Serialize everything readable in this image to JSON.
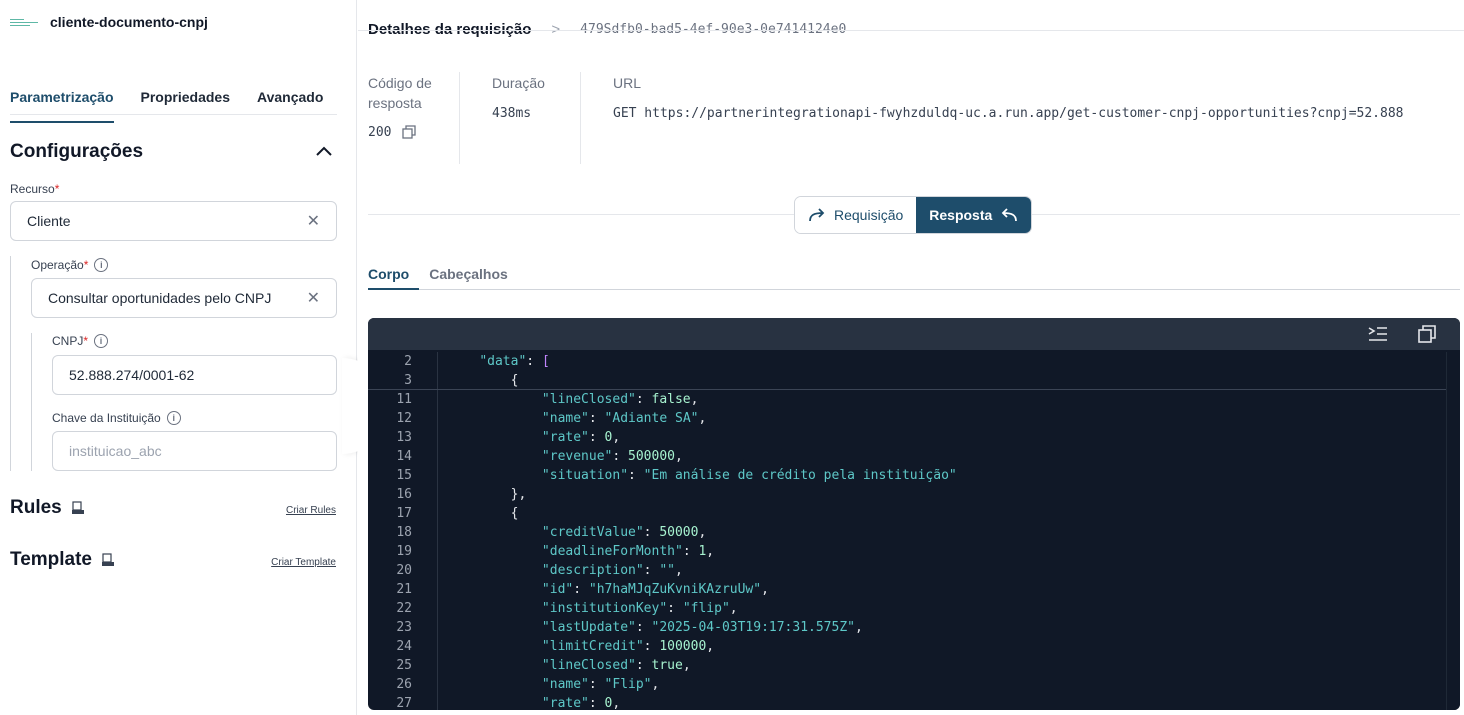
{
  "node": {
    "title": "cliente-documento-cnpj"
  },
  "tabs": [
    "Parametrização",
    "Propriedades",
    "Avançado"
  ],
  "config": {
    "title": "Configurações",
    "recurso_label": "Recurso",
    "recurso_value": "Cliente",
    "operacao_label": "Operação",
    "operacao_value": "Consultar oportunidades pelo CNPJ",
    "cnpj_label": "CNPJ",
    "cnpj_value": "52.888.274/0001-62",
    "chave_label": "Chave da Instituição",
    "chave_placeholder": "instituicao_abc",
    "required_mark": "*",
    "info_glyph": "i"
  },
  "rules": {
    "title": "Rules",
    "link": "Criar Rules",
    "icon": "doc-icon"
  },
  "template": {
    "title": "Template",
    "link": "Criar Template",
    "icon": "doc-icon"
  },
  "request": {
    "heading": "Detalhes da requisição",
    "sep": ">",
    "id": "479Sdfb0-bad5-4ef-90e3-0e7414124e0",
    "code_label": "Código de resposta",
    "code_value": "200",
    "duration_label": "Duração",
    "duration_value": "438ms",
    "url_label": "URL",
    "url_value": "GET https://partnerintegrationapi-fwyhzduldq-uc.a.run.app/get-customer-cnpj-opportunities?cnpj=52.888"
  },
  "toggle": {
    "requisicao": "Requisição",
    "resposta": "Resposta"
  },
  "subtabs": [
    "Corpo",
    "Cabeçalhos"
  ],
  "code_lines": [
    {
      "n": "2",
      "indent": "    ",
      "parts": [
        [
          "k",
          "\"data\""
        ],
        [
          "p",
          ": "
        ],
        [
          "b",
          "["
        ]
      ]
    },
    {
      "n": "3",
      "indent": "        ",
      "parts": [
        [
          "p",
          "{"
        ]
      ]
    },
    {
      "n": "11",
      "indent": "            ",
      "parts": [
        [
          "k",
          "\"lineClosed\""
        ],
        [
          "p",
          ": "
        ],
        [
          "n",
          "false"
        ],
        [
          "p",
          ","
        ]
      ]
    },
    {
      "n": "12",
      "indent": "            ",
      "parts": [
        [
          "k",
          "\"name\""
        ],
        [
          "p",
          ": "
        ],
        [
          "s",
          "\"Adiante SA\""
        ],
        [
          "p",
          ","
        ]
      ]
    },
    {
      "n": "13",
      "indent": "            ",
      "parts": [
        [
          "k",
          "\"rate\""
        ],
        [
          "p",
          ": "
        ],
        [
          "n",
          "0"
        ],
        [
          "p",
          ","
        ]
      ]
    },
    {
      "n": "14",
      "indent": "            ",
      "parts": [
        [
          "k",
          "\"revenue\""
        ],
        [
          "p",
          ": "
        ],
        [
          "n",
          "500000"
        ],
        [
          "p",
          ","
        ]
      ]
    },
    {
      "n": "15",
      "indent": "            ",
      "parts": [
        [
          "k",
          "\"situation\""
        ],
        [
          "p",
          ": "
        ],
        [
          "s",
          "\"Em análise de crédito pela instituição\""
        ]
      ]
    },
    {
      "n": "16",
      "indent": "        ",
      "parts": [
        [
          "p",
          "},"
        ]
      ]
    },
    {
      "n": "17",
      "indent": "        ",
      "parts": [
        [
          "p",
          "{"
        ]
      ]
    },
    {
      "n": "18",
      "indent": "            ",
      "parts": [
        [
          "k",
          "\"creditValue\""
        ],
        [
          "p",
          ": "
        ],
        [
          "n",
          "50000"
        ],
        [
          "p",
          ","
        ]
      ]
    },
    {
      "n": "19",
      "indent": "            ",
      "parts": [
        [
          "k",
          "\"deadlineForMonth\""
        ],
        [
          "p",
          ": "
        ],
        [
          "n",
          "1"
        ],
        [
          "p",
          ","
        ]
      ]
    },
    {
      "n": "20",
      "indent": "            ",
      "parts": [
        [
          "k",
          "\"description\""
        ],
        [
          "p",
          ": "
        ],
        [
          "s",
          "\"\""
        ],
        [
          "p",
          ","
        ]
      ]
    },
    {
      "n": "21",
      "indent": "            ",
      "parts": [
        [
          "k",
          "\"id\""
        ],
        [
          "p",
          ": "
        ],
        [
          "s",
          "\"h7haMJqZuKvniKAzruUw\""
        ],
        [
          "p",
          ","
        ]
      ]
    },
    {
      "n": "22",
      "indent": "            ",
      "parts": [
        [
          "k",
          "\"institutionKey\""
        ],
        [
          "p",
          ": "
        ],
        [
          "s",
          "\"flip\""
        ],
        [
          "p",
          ","
        ]
      ]
    },
    {
      "n": "23",
      "indent": "            ",
      "parts": [
        [
          "k",
          "\"lastUpdate\""
        ],
        [
          "p",
          ": "
        ],
        [
          "s",
          "\"2025-04-03T19:17:31.575Z\""
        ],
        [
          "p",
          ","
        ]
      ]
    },
    {
      "n": "24",
      "indent": "            ",
      "parts": [
        [
          "k",
          "\"limitCredit\""
        ],
        [
          "p",
          ": "
        ],
        [
          "n",
          "100000"
        ],
        [
          "p",
          ","
        ]
      ]
    },
    {
      "n": "25",
      "indent": "            ",
      "parts": [
        [
          "k",
          "\"lineClosed\""
        ],
        [
          "p",
          ": "
        ],
        [
          "n",
          "true"
        ],
        [
          "p",
          ","
        ]
      ]
    },
    {
      "n": "26",
      "indent": "            ",
      "parts": [
        [
          "k",
          "\"name\""
        ],
        [
          "p",
          ": "
        ],
        [
          "s",
          "\"Flip\""
        ],
        [
          "p",
          ","
        ]
      ]
    },
    {
      "n": "27",
      "indent": "            ",
      "parts": [
        [
          "k",
          "\"rate\""
        ],
        [
          "p",
          ": "
        ],
        [
          "n",
          "0"
        ],
        [
          "p",
          ","
        ]
      ]
    }
  ],
  "colors": {
    "primary": "#1e4d6b",
    "editor_bg": "#101827",
    "key": "#5ec8c8"
  }
}
